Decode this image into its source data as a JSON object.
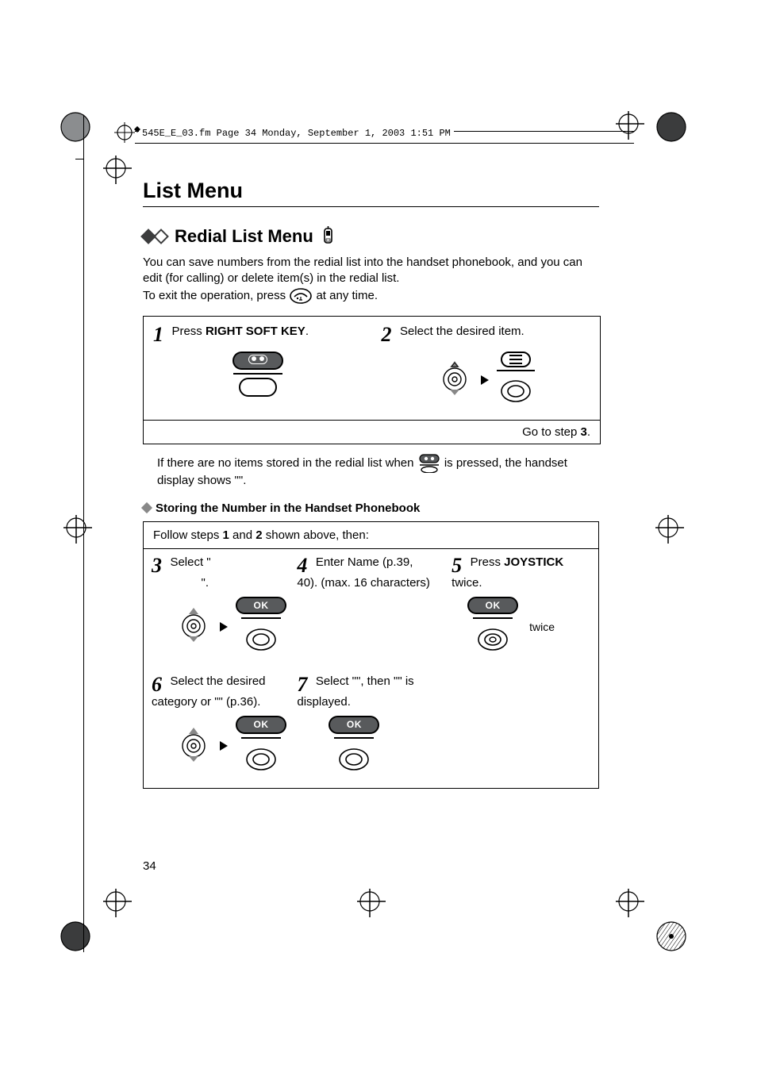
{
  "fm_header": "545E_E_03.fm  Page 34  Monday, September 1, 2003  1:51 PM",
  "section_title": "List Menu",
  "sub_title": "Redial List Menu",
  "intro_line_1": "You can save numbers from the redial list into the handset phonebook, and you can edit (for calling) or delete item(s) in the redial list.",
  "intro_line_2_pre": "To exit the operation, press ",
  "intro_line_2_post": " at any time.",
  "step1_pre": "Press ",
  "step1_bold": "RIGHT SOFT KEY",
  "step1_post": ".",
  "step2_text": "Select the desired item.",
  "goto_text_pre": "Go to step ",
  "goto_text_bold": "3",
  "goto_text_post": ".",
  "note_pre": "If there are no items stored in the redial list when ",
  "note_mid": " is pressed, the handset display shows \"",
  "note_listempty": "",
  "note_post": "\".",
  "sub_proc_title": "Storing the Number in the Handset Phonebook",
  "follow_top_pre": "Follow steps ",
  "follow_top_b1": "1",
  "follow_top_mid": " and ",
  "follow_top_b2": "2",
  "follow_top_post": " shown above, then:",
  "step3_text_a": "Select \"",
  "step3_text_b": "",
  "step3_text_c": "\".",
  "step4_text": "Enter Name (p.39, 40). (max. 16 characters)",
  "step5_text_pre": "Press ",
  "step5_text_bold": "JOYSTICK",
  "step5_text_post": " twice.",
  "step6_text_a": "Select the desired category or \"",
  "step6_text_b": "",
  "step6_text_c": "\" (p.36).",
  "step7_text_a": "Select \"",
  "step7_text_b": "",
  "step7_text_c": "\", then \"",
  "step7_text_d": "",
  "step7_text_e": "\" is displayed.",
  "twice_label": "twice",
  "ok_label": "OK",
  "page_number": "34"
}
